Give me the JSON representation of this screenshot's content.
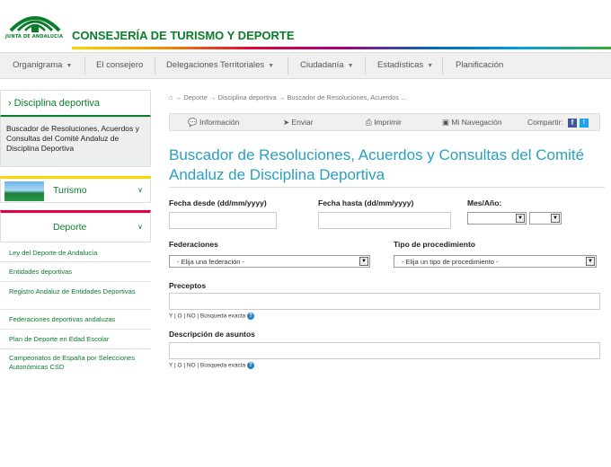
{
  "header": {
    "logo_text": "JUNTA DE ANDALUCIA",
    "title": "CONSEJERÍA DE TURISMO Y DEPORTE"
  },
  "nav": {
    "items": [
      {
        "label": "Organigrama",
        "has_dropdown": true
      },
      {
        "label": "El consejero",
        "has_dropdown": false
      },
      {
        "label": "Delegaciones Territoriales",
        "has_dropdown": true
      },
      {
        "label": "Ciudadanía",
        "has_dropdown": true
      },
      {
        "label": "Estadísticas",
        "has_dropdown": true
      },
      {
        "label": "Planificación",
        "has_dropdown": false
      }
    ]
  },
  "sidebar": {
    "heading": "Disciplina deportiva",
    "description": "Buscador de Resoluciones, Acuerdos y Consultas del Comité Andaluz de Disciplina Deportiva",
    "sections": [
      {
        "label": "Turismo"
      },
      {
        "label": "Deporte"
      }
    ],
    "links": [
      "Ley del Deporte de Andalucía",
      "Entidades deportivas",
      "Registro Andaluz de Entidades Deportivas",
      "Federaciones deportivas andaluzas",
      "Plan de Deporte en Edad Escolar",
      "Campeonatos de España por Selecciones Autonómicas CSD"
    ]
  },
  "breadcrumb": [
    "Deporte",
    "Disciplina deportiva",
    "Buscador de Resoluciones, Acuerdos ..."
  ],
  "toolbar": {
    "info": "Información",
    "send": "Enviar",
    "print": "Imprimir",
    "my_nav": "Mi Navegación",
    "share": "Compartir:"
  },
  "page_title": "Buscador de Resoluciones, Acuerdos y Consultas del Comité Andaluz de Disciplina Deportiva",
  "form": {
    "fecha_desde": "Fecha desde (dd/mm/yyyy)",
    "fecha_hasta": "Fecha hasta (dd/mm/yyyy)",
    "mes_anio": "Mes/Año:",
    "federaciones": "Federaciones",
    "federaciones_select": "- Elija una federación -",
    "tipo_procedimiento": "Tipo de procedimiento",
    "tipo_select": "- Elija un tipo de procedimiento -",
    "preceptos": "Preceptos",
    "descripcion": "Descripción de asuntos",
    "hint": "Y | O | NO | Búsqueda exacta"
  },
  "colors": {
    "brand_green": "#0a7d2c",
    "title_blue": "#2a9fc0"
  }
}
